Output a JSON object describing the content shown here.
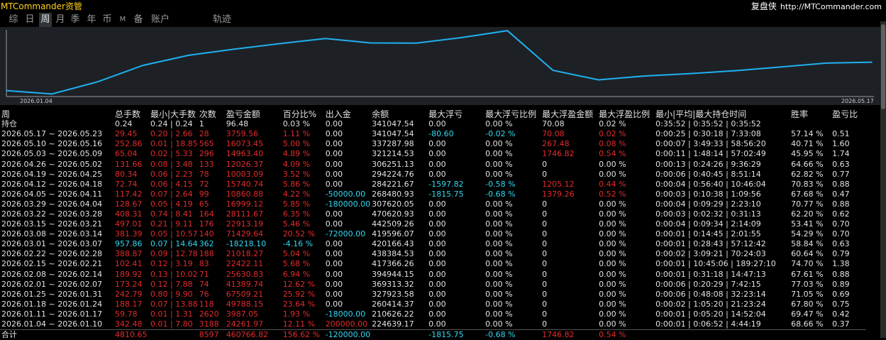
{
  "app": {
    "title": "MTCommander资管",
    "link_name": "复盘侠",
    "link_url": "http://MTCommander.com"
  },
  "tabs": [
    {
      "label": "综",
      "active": false
    },
    {
      "label": "日",
      "active": false
    },
    {
      "label": "周",
      "active": true
    },
    {
      "label": "月",
      "active": false
    },
    {
      "label": "季",
      "active": false
    },
    {
      "label": "年",
      "active": false
    },
    {
      "label": "币",
      "active": false
    },
    {
      "label": "M",
      "active": false
    },
    {
      "label": "备",
      "active": false
    },
    {
      "label": "账户",
      "active": false
    },
    {
      "label": "轨迹",
      "active": false
    }
  ],
  "colors": {
    "accent_line": "#1fb0f0",
    "loss": "#e12b2b",
    "cyan": "#33d7f0",
    "title": "#ffd21e"
  },
  "chart_data": {
    "type": "line",
    "x_start_label": "2026.01.04",
    "x_end_label": "2026.05.17",
    "x": [
      "2026.01.04",
      "2026.01.11",
      "2026.01.18",
      "2026.01.25",
      "2026.02.01",
      "2026.02.08",
      "2026.02.15",
      "2026.02.22",
      "2026.03.01",
      "2026.03.08",
      "2026.03.15",
      "2026.03.22",
      "2026.03.29",
      "2026.04.05",
      "2026.04.12",
      "2026.04.19",
      "2026.04.26",
      "2026.05.03",
      "2026.05.10",
      "2026.05.17"
    ],
    "series": [
      {
        "values": [
          224639.17,
          210626.22,
          260414.37,
          327923.58,
          369313.32,
          394944.15,
          417366.26,
          438384.53,
          420166.43,
          419596.07,
          442509.26,
          470620.93,
          307620.05,
          268480.93,
          284221.67,
          294224.76,
          306251.13,
          321214.53,
          337287.98,
          341047.54
        ]
      }
    ]
  },
  "table": {
    "headers": [
      "周",
      "总手数",
      "最小|大手数",
      "次数",
      "盈亏金额",
      "百分比%",
      "出入金",
      "余额",
      "最大浮亏",
      "最大浮亏比例",
      "最大浮盈金额",
      "最大浮盈比例",
      "最小|平均|最大持仓时间",
      "胜率",
      "盈亏比"
    ],
    "holding": {
      "c": [
        "持仓",
        "0.24",
        "0.24 | 0.24",
        "1",
        "96.48",
        "0.03 %",
        "0.00",
        "341047.54",
        "0.00",
        "0.00 %",
        "70.08",
        "0.02 %",
        "0:35:52 | 0:35:52 | 0:35:52",
        "",
        ""
      ],
      "k": [
        "w",
        "r",
        "r",
        "r",
        "r",
        "r",
        "w",
        "w",
        "w",
        "w",
        "r",
        "r",
        "w",
        "w",
        "w"
      ]
    },
    "rows": [
      {
        "c": [
          "2026.05.17 ~ 2026.05.23",
          "29.45",
          "0.20 | 2.66",
          "28",
          "3759.56",
          "1.11 %",
          "0.00",
          "341047.54",
          "-80.60",
          "-0.02 %",
          "70.08",
          "0.02 %",
          "0:00:25 | 0:30:18 | 7:33:08",
          "57.14 %",
          "0.51"
        ],
        "k": [
          "w",
          "r",
          "r",
          "r",
          "r",
          "r",
          "w",
          "w",
          "c",
          "c",
          "r",
          "r",
          "w",
          "w",
          "w"
        ]
      },
      {
        "c": [
          "2026.05.10 ~ 2026.05.16",
          "252.86",
          "0.01 | 18.85",
          "565",
          "16073.45",
          "5.00 %",
          "0.00",
          "337287.98",
          "0.00",
          "0.00 %",
          "267.48",
          "0.08 %",
          "0:00:07 | 3:49:33 | 58:56:20",
          "40.71 %",
          "1.60"
        ],
        "k": [
          "w",
          "r",
          "r",
          "r",
          "r",
          "r",
          "w",
          "w",
          "w",
          "w",
          "r",
          "r",
          "w",
          "w",
          "w"
        ]
      },
      {
        "c": [
          "2026.05.03 ~ 2026.05.09",
          "65.04",
          "0.02 | 5.33",
          "296",
          "14963.40",
          "4.89 %",
          "0.00",
          "321214.53",
          "0.00",
          "0.00 %",
          "1746.82",
          "0.54 %",
          "0:00:11 | 1:48:14 | 57:02:49",
          "45.95 %",
          "1.74"
        ],
        "k": [
          "w",
          "r",
          "r",
          "r",
          "r",
          "r",
          "w",
          "w",
          "w",
          "w",
          "r",
          "r",
          "w",
          "w",
          "w"
        ]
      },
      {
        "c": [
          "2026.04.26 ~ 2026.05.02",
          "131.66",
          "0.08 | 3.48",
          "133",
          "12026.37",
          "4.09 %",
          "0.00",
          "306251.13",
          "0.00",
          "0.00 %",
          "0",
          "0.00 %",
          "0:00:13 | 0:24:26 | 9:36:29",
          "64.66 %",
          "0.63"
        ],
        "k": [
          "w",
          "r",
          "r",
          "r",
          "r",
          "r",
          "w",
          "w",
          "w",
          "w",
          "w",
          "w",
          "w",
          "w",
          "w"
        ]
      },
      {
        "c": [
          "2026.04.19 ~ 2026.04.25",
          "80.34",
          "0.06 | 2.23",
          "78",
          "10003.09",
          "3.52 %",
          "0.00",
          "294224.76",
          "0.00",
          "0.00 %",
          "0",
          "0.00 %",
          "0:00:06 | 0:40:45 | 8:51:14",
          "62.82 %",
          "0.77"
        ],
        "k": [
          "w",
          "r",
          "r",
          "r",
          "r",
          "r",
          "w",
          "w",
          "w",
          "w",
          "w",
          "w",
          "w",
          "w",
          "w"
        ]
      },
      {
        "c": [
          "2026.04.12 ~ 2026.04.18",
          "72.74",
          "0.06 | 4.15",
          "72",
          "15740.74",
          "5.86 %",
          "0.00",
          "284221.67",
          "-1597.82",
          "-0.58 %",
          "1205.12",
          "0.44 %",
          "0:00:04 | 0:56:40 | 10:46:04",
          "70.83 %",
          "0.88"
        ],
        "k": [
          "w",
          "r",
          "r",
          "r",
          "r",
          "r",
          "w",
          "w",
          "c",
          "c",
          "r",
          "r",
          "w",
          "w",
          "w"
        ]
      },
      {
        "c": [
          "2026.04.05 ~ 2026.04.11",
          "117.42",
          "0.07 | 2.64",
          "99",
          "10860.88",
          "4.22 %",
          "-50000.00",
          "268480.93",
          "-1815.75",
          "-0.68 %",
          "1379.26",
          "0.52 %",
          "0:00:03 | 0:10:38 | 1:09:56",
          "67.68 %",
          "0.47"
        ],
        "k": [
          "w",
          "r",
          "r",
          "r",
          "r",
          "r",
          "c",
          "w",
          "c",
          "c",
          "r",
          "r",
          "w",
          "w",
          "w"
        ]
      },
      {
        "c": [
          "2026.03.29 ~ 2026.04.04",
          "128.67",
          "0.05 | 4.19",
          "65",
          "16999.12",
          "5.85 %",
          "-180000.00",
          "307620.05",
          "0.00",
          "0.00 %",
          "0",
          "0.00 %",
          "0:00:04 | 0:09:29 | 2:23:10",
          "70.77 %",
          "0.88"
        ],
        "k": [
          "w",
          "r",
          "r",
          "r",
          "r",
          "r",
          "c",
          "w",
          "w",
          "w",
          "w",
          "w",
          "w",
          "w",
          "w"
        ]
      },
      {
        "c": [
          "2026.03.22 ~ 2026.03.28",
          "408.31",
          "0.74 | 8.41",
          "164",
          "28111.67",
          "6.35 %",
          "0.00",
          "470620.93",
          "0.00",
          "0.00 %",
          "0",
          "0.00 %",
          "0:00:03 | 0:02:32 | 0:31:13",
          "62.20 %",
          "0.62"
        ],
        "k": [
          "w",
          "r",
          "r",
          "r",
          "r",
          "r",
          "w",
          "w",
          "w",
          "w",
          "w",
          "w",
          "w",
          "w",
          "w"
        ]
      },
      {
        "c": [
          "2026.03.15 ~ 2026.03.21",
          "497.01",
          "0.21 | 9.11",
          "176",
          "22913.19",
          "5.46 %",
          "0.00",
          "442509.26",
          "0.00",
          "0.00 %",
          "0",
          "0.00 %",
          "0:00:04 | 0:09:34 | 2:14:09",
          "53.41 %",
          "0.70"
        ],
        "k": [
          "w",
          "r",
          "r",
          "r",
          "r",
          "r",
          "w",
          "w",
          "w",
          "w",
          "w",
          "w",
          "w",
          "w",
          "w"
        ]
      },
      {
        "c": [
          "2026.03.08 ~ 2026.03.14",
          "381.39",
          "0.05 | 10.57",
          "140",
          "71429.64",
          "20.52 %",
          "-72000.00",
          "419596.07",
          "0.00",
          "0.00 %",
          "0",
          "0.00 %",
          "0:00:01 | 0:14:45 | 2:01:55",
          "54.29 %",
          "0.70"
        ],
        "k": [
          "w",
          "r",
          "r",
          "r",
          "r",
          "r",
          "c",
          "w",
          "w",
          "w",
          "w",
          "w",
          "w",
          "w",
          "w"
        ]
      },
      {
        "c": [
          "2026.03.01 ~ 2026.03.07",
          "957.86",
          "0.07 | 14.64",
          "362",
          "-18218.10",
          "-4.16 %",
          "0.00",
          "420166.43",
          "0.00",
          "0.00 %",
          "0",
          "0.00 %",
          "0:00:01 | 0:28:43 | 57:12:42",
          "58.84 %",
          "0.63"
        ],
        "k": [
          "w",
          "c",
          "c",
          "c",
          "c",
          "c",
          "w",
          "w",
          "w",
          "w",
          "w",
          "w",
          "w",
          "w",
          "w"
        ]
      },
      {
        "c": [
          "2026.02.22 ~ 2026.02.28",
          "388.87",
          "0.09 | 12.78",
          "188",
          "21018.27",
          "5.04 %",
          "0.00",
          "438384.53",
          "0.00",
          "0.00 %",
          "0",
          "0.00 %",
          "0:00:02 | 3:09:21 | 70:24:03",
          "60.64 %",
          "0.79"
        ],
        "k": [
          "w",
          "r",
          "r",
          "r",
          "r",
          "r",
          "w",
          "w",
          "w",
          "w",
          "w",
          "w",
          "w",
          "w",
          "w"
        ]
      },
      {
        "c": [
          "2026.02.15 ~ 2026.02.21",
          "102.41",
          "0.12 | 3.19",
          "83",
          "22422.11",
          "5.68 %",
          "0.00",
          "417366.26",
          "0.00",
          "0.00 %",
          "0",
          "0.00 %",
          "0:00:01 | 10:45:06 | 189:27:10",
          "74.70 %",
          "1.38"
        ],
        "k": [
          "w",
          "r",
          "r",
          "r",
          "r",
          "r",
          "w",
          "w",
          "w",
          "w",
          "w",
          "w",
          "w",
          "w",
          "w"
        ]
      },
      {
        "c": [
          "2026.02.08 ~ 2026.02.14",
          "189.92",
          "0.13 | 10.02",
          "71",
          "25630.83",
          "6.94 %",
          "0.00",
          "394944.15",
          "0.00",
          "0.00 %",
          "0",
          "0.00 %",
          "0:00:01 | 0:31:18 | 14:47:13",
          "67.61 %",
          "0.88"
        ],
        "k": [
          "w",
          "r",
          "r",
          "r",
          "r",
          "r",
          "w",
          "w",
          "w",
          "w",
          "w",
          "w",
          "w",
          "w",
          "w"
        ]
      },
      {
        "c": [
          "2026.02.01 ~ 2026.02.07",
          "173.24",
          "0.12 | 7.88",
          "74",
          "41389.74",
          "12.62 %",
          "0.00",
          "369313.32",
          "0.00",
          "0.00 %",
          "0",
          "0.00 %",
          "0:00:06 | 0:20:29 | 7:42:15",
          "77.03 %",
          "0.89"
        ],
        "k": [
          "w",
          "r",
          "r",
          "r",
          "r",
          "r",
          "w",
          "w",
          "w",
          "w",
          "w",
          "w",
          "w",
          "w",
          "w"
        ]
      },
      {
        "c": [
          "2026.01.25 ~ 2026.01.31",
          "242.79",
          "0.80 | 9.90",
          "76",
          "67509.21",
          "25.92 %",
          "0.00",
          "327923.58",
          "0.00",
          "0.00 %",
          "0",
          "0.00 %",
          "0:00:06 | 0:48:08 | 32:23:14",
          "71.05 %",
          "0.69"
        ],
        "k": [
          "w",
          "r",
          "r",
          "r",
          "r",
          "r",
          "w",
          "w",
          "w",
          "w",
          "w",
          "w",
          "w",
          "w",
          "w"
        ]
      },
      {
        "c": [
          "2026.01.18 ~ 2026.01.24",
          "188.17",
          "0.07 | 13.88",
          "118",
          "49788.15",
          "23.64 %",
          "0.00",
          "260414.37",
          "0.00",
          "0.00 %",
          "0",
          "0.00 %",
          "0:00:02 | 1:05:20 | 21:23:24",
          "67.80 %",
          "0.75"
        ],
        "k": [
          "w",
          "r",
          "r",
          "r",
          "r",
          "r",
          "w",
          "w",
          "w",
          "w",
          "w",
          "w",
          "w",
          "w",
          "w"
        ]
      },
      {
        "c": [
          "2026.01.11 ~ 2026.01.17",
          "59.78",
          "0.01 | 1.31",
          "2620",
          "3987.05",
          "1.93 %",
          "-18000.00",
          "210626.22",
          "0.00",
          "0.00 %",
          "0",
          "0.00 %",
          "0:00:01 | 0:05:20 | 14:52:04",
          "69.47 %",
          "0.42"
        ],
        "k": [
          "w",
          "r",
          "r",
          "r",
          "r",
          "r",
          "c",
          "w",
          "w",
          "w",
          "w",
          "w",
          "w",
          "w",
          "w"
        ]
      },
      {
        "c": [
          "2026.01.04 ~ 2026.01.10",
          "342.48",
          "0.01 | 7.80",
          "3188",
          "24261.97",
          "12.11 %",
          "200000.00",
          "224639.17",
          "0.00",
          "0.00 %",
          "0",
          "0.00 %",
          "0:00:01 | 0:06:52 | 4:44:19",
          "68.66 %",
          "0.37"
        ],
        "k": [
          "w",
          "r",
          "r",
          "r",
          "r",
          "r",
          "r",
          "w",
          "w",
          "w",
          "w",
          "w",
          "w",
          "w",
          "w"
        ]
      }
    ],
    "total": {
      "c": [
        "合计",
        "4810.65",
        "",
        "8597",
        "460766.82",
        "156.62 %",
        "-120000.00",
        "",
        "-1815.75",
        "-0.68 %",
        "1746.82",
        "0.54 %",
        "",
        "",
        ""
      ],
      "k": [
        "w",
        "r",
        "w",
        "r",
        "r",
        "r",
        "c",
        "w",
        "c",
        "c",
        "r",
        "r",
        "w",
        "w",
        "w"
      ]
    }
  }
}
